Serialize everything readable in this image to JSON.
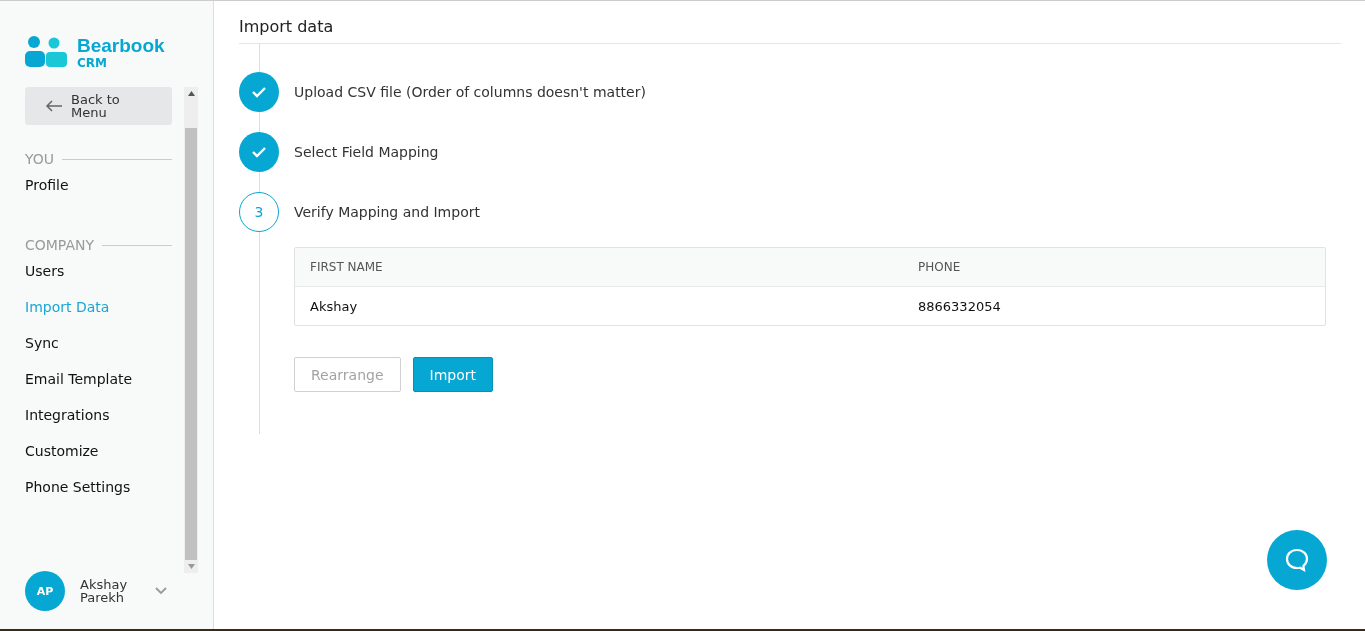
{
  "brand": {
    "name": "Bearbook",
    "sub": "CRM"
  },
  "back_button": "Back to Menu",
  "sidebar": {
    "sections": [
      {
        "title": "YOU",
        "items": [
          {
            "label": "Profile",
            "selected": false
          }
        ]
      },
      {
        "title": "COMPANY",
        "items": [
          {
            "label": "Users",
            "selected": false
          },
          {
            "label": "Import Data",
            "selected": true
          },
          {
            "label": "Sync",
            "selected": false
          },
          {
            "label": "Email Template",
            "selected": false
          },
          {
            "label": "Integrations",
            "selected": false
          },
          {
            "label": "Customize",
            "selected": false
          },
          {
            "label": "Phone Settings",
            "selected": false
          }
        ]
      }
    ]
  },
  "user": {
    "initials": "AP",
    "name": "Akshay Parekh"
  },
  "page_title": "Import data",
  "steps": [
    {
      "kind": "done",
      "label": "Upload CSV file (Order of columns doesn't matter)"
    },
    {
      "kind": "done",
      "label": "Select Field Mapping"
    },
    {
      "kind": "current",
      "number": "3",
      "label": "Verify Mapping and Import"
    }
  ],
  "table": {
    "columns": [
      "FIRST NAME",
      "PHONE"
    ],
    "rows": [
      [
        "Akshay",
        "8866332054"
      ]
    ]
  },
  "buttons": [
    {
      "label": "Rearrange",
      "kind": "secondary",
      "disabled": true
    },
    {
      "label": "Import",
      "kind": "primary",
      "disabled": false
    }
  ]
}
